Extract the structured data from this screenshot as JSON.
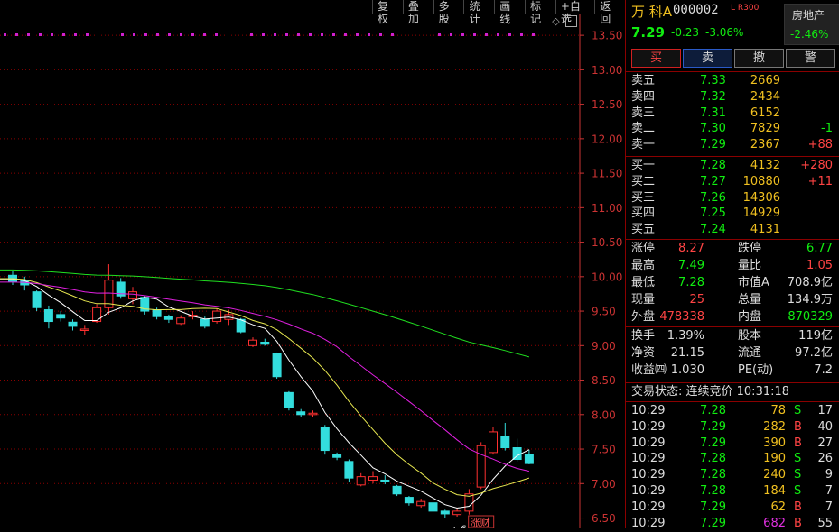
{
  "toolbar": [
    "复权",
    "叠加",
    "多股",
    "统计",
    "画线",
    "标记",
    "+自选",
    "返回"
  ],
  "chart": {
    "y_ticks": [
      "13.50",
      "13.00",
      "12.50",
      "12.00",
      "11.50",
      "11.00",
      "10.50",
      "10.00",
      "9.50",
      "9.00",
      "8.50",
      "8.00",
      "7.50",
      "7.00",
      "6.50"
    ],
    "low_marker": "6.45",
    "event_label": "涨财",
    "colors": {
      "up": "#ff3030",
      "down": "#33dddd",
      "ma5": "#ffffff",
      "ma10": "#e8e850",
      "ma20": "#e020e0",
      "ma60": "#20e020",
      "grid": "#8b0000",
      "axis": "#cc3333"
    }
  },
  "chart_data": {
    "type": "candlestick",
    "ylim": [
      6.35,
      13.75
    ],
    "candles": [
      {
        "o": 10.02,
        "c": 9.93,
        "h": 10.08,
        "l": 9.88
      },
      {
        "o": 9.95,
        "c": 9.88,
        "h": 10.0,
        "l": 9.8
      },
      {
        "o": 9.78,
        "c": 9.55,
        "h": 9.8,
        "l": 9.5
      },
      {
        "o": 9.52,
        "c": 9.35,
        "h": 9.58,
        "l": 9.25
      },
      {
        "o": 9.45,
        "c": 9.4,
        "h": 9.5,
        "l": 9.35
      },
      {
        "o": 9.34,
        "c": 9.28,
        "h": 9.38,
        "l": 9.22
      },
      {
        "o": 9.22,
        "c": 9.24,
        "h": 9.3,
        "l": 9.15
      },
      {
        "o": 9.35,
        "c": 9.55,
        "h": 9.6,
        "l": 9.33
      },
      {
        "o": 9.55,
        "c": 9.95,
        "h": 10.18,
        "l": 9.45
      },
      {
        "o": 9.92,
        "c": 9.72,
        "h": 9.98,
        "l": 9.68
      },
      {
        "o": 9.68,
        "c": 9.78,
        "h": 9.85,
        "l": 9.6
      },
      {
        "o": 9.7,
        "c": 9.5,
        "h": 9.72,
        "l": 9.45
      },
      {
        "o": 9.52,
        "c": 9.42,
        "h": 9.55,
        "l": 9.38
      },
      {
        "o": 9.42,
        "c": 9.38,
        "h": 9.45,
        "l": 9.33
      },
      {
        "o": 9.32,
        "c": 9.4,
        "h": 9.44,
        "l": 9.3
      },
      {
        "o": 9.42,
        "c": 9.44,
        "h": 9.5,
        "l": 9.38
      },
      {
        "o": 9.38,
        "c": 9.28,
        "h": 9.42,
        "l": 9.25
      },
      {
        "o": 9.35,
        "c": 9.5,
        "h": 9.54,
        "l": 9.32
      },
      {
        "o": 9.38,
        "c": 9.45,
        "h": 9.52,
        "l": 9.3
      },
      {
        "o": 9.38,
        "c": 9.2,
        "h": 9.4,
        "l": 9.18
      },
      {
        "o": 9.0,
        "c": 9.08,
        "h": 9.12,
        "l": 8.98
      },
      {
        "o": 9.05,
        "c": 9.02,
        "h": 9.1,
        "l": 9.0
      },
      {
        "o": 8.88,
        "c": 8.55,
        "h": 8.9,
        "l": 8.52
      },
      {
        "o": 8.32,
        "c": 8.1,
        "h": 8.34,
        "l": 8.06
      },
      {
        "o": 8.04,
        "c": 8.0,
        "h": 8.08,
        "l": 7.96
      },
      {
        "o": 8.0,
        "c": 8.02,
        "h": 8.06,
        "l": 7.96
      },
      {
        "o": 7.82,
        "c": 7.48,
        "h": 7.85,
        "l": 7.42
      },
      {
        "o": 7.42,
        "c": 7.38,
        "h": 7.45,
        "l": 7.34
      },
      {
        "o": 7.32,
        "c": 7.08,
        "h": 7.35,
        "l": 7.02
      },
      {
        "o": 6.98,
        "c": 7.1,
        "h": 7.15,
        "l": 6.96
      },
      {
        "o": 7.05,
        "c": 7.1,
        "h": 7.18,
        "l": 7.0
      },
      {
        "o": 7.05,
        "c": 7.04,
        "h": 7.12,
        "l": 6.99
      },
      {
        "o": 6.96,
        "c": 6.85,
        "h": 6.98,
        "l": 6.82
      },
      {
        "o": 6.8,
        "c": 6.72,
        "h": 6.82,
        "l": 6.68
      },
      {
        "o": 6.68,
        "c": 6.74,
        "h": 6.78,
        "l": 6.65
      },
      {
        "o": 6.72,
        "c": 6.6,
        "h": 6.74,
        "l": 6.55
      },
      {
        "o": 6.6,
        "c": 6.56,
        "h": 6.62,
        "l": 6.5
      },
      {
        "o": 6.55,
        "c": 6.6,
        "h": 6.65,
        "l": 6.52
      },
      {
        "o": 6.6,
        "c": 6.85,
        "h": 6.92,
        "l": 6.55
      },
      {
        "o": 6.95,
        "c": 7.55,
        "h": 7.6,
        "l": 6.92
      },
      {
        "o": 7.45,
        "c": 7.75,
        "h": 7.82,
        "l": 7.42
      },
      {
        "o": 7.68,
        "c": 7.52,
        "h": 7.88,
        "l": 7.48
      },
      {
        "o": 7.52,
        "c": 7.35,
        "h": 7.65,
        "l": 7.32
      },
      {
        "o": 7.42,
        "c": 7.29,
        "h": 7.49,
        "l": 7.28
      }
    ]
  },
  "quote": {
    "name": "万 科A",
    "code": "000002",
    "tags": "L R300",
    "price": "7.29",
    "change": "-0.23",
    "change_pct": "-3.06%",
    "sector": "房地产",
    "sector_pct": "-2.46%"
  },
  "buttons": {
    "buy": "买",
    "sell": "卖",
    "cancel": "撤",
    "alert": "警"
  },
  "asks": [
    {
      "label": "卖五",
      "price": "7.33",
      "vol": "2669",
      "delta": ""
    },
    {
      "label": "卖四",
      "price": "7.32",
      "vol": "2434",
      "delta": ""
    },
    {
      "label": "卖三",
      "price": "7.31",
      "vol": "6152",
      "delta": ""
    },
    {
      "label": "卖二",
      "price": "7.30",
      "vol": "7829",
      "delta": "-1"
    },
    {
      "label": "卖一",
      "price": "7.29",
      "vol": "2367",
      "delta": "+88"
    }
  ],
  "bids": [
    {
      "label": "买一",
      "price": "7.28",
      "vol": "4132",
      "delta": "+280"
    },
    {
      "label": "买二",
      "price": "7.27",
      "vol": "10880",
      "delta": "+11"
    },
    {
      "label": "买三",
      "price": "7.26",
      "vol": "14306",
      "delta": ""
    },
    {
      "label": "买四",
      "price": "7.25",
      "vol": "14929",
      "delta": ""
    },
    {
      "label": "买五",
      "price": "7.24",
      "vol": "4131",
      "delta": ""
    }
  ],
  "stats1": [
    {
      "l": "涨停",
      "lv": "8.27",
      "lc": "p-red",
      "r": "跌停",
      "rv": "6.77",
      "rc": "p-green"
    },
    {
      "l": "最高",
      "lv": "7.49",
      "lc": "p-green",
      "r": "量比",
      "rv": "1.05",
      "rc": "p-red"
    },
    {
      "l": "最低",
      "lv": "7.28",
      "lc": "p-green",
      "r": "市值A",
      "rv": "708.9亿",
      "rc": "p-white"
    },
    {
      "l": "现量",
      "lv": "25",
      "lc": "p-red",
      "r": "总量",
      "rv": "134.9万",
      "rc": "p-white"
    },
    {
      "l": "外盘",
      "lv": "478338",
      "lc": "p-red",
      "r": "内盘",
      "rv": "870329",
      "rc": "p-green"
    }
  ],
  "stats2": [
    {
      "l": "换手",
      "lv": "1.39%",
      "lc": "p-white",
      "r": "股本",
      "rv": "119亿",
      "rc": "p-white"
    },
    {
      "l": "净资",
      "lv": "21.15",
      "lc": "p-white",
      "r": "流通",
      "rv": "97.2亿",
      "rc": "p-white"
    },
    {
      "l": "收益㈣",
      "lv": "1.030",
      "lc": "p-white",
      "r": "PE(动)",
      "rv": "7.2",
      "rc": "p-white"
    }
  ],
  "trade_status": "交易状态: 连续竞价 10:31:18",
  "ticks": [
    {
      "t": "10:29",
      "p": "7.28",
      "v": "78",
      "bs": "S",
      "n": "17"
    },
    {
      "t": "10:29",
      "p": "7.29",
      "v": "282",
      "bs": "B",
      "n": "40"
    },
    {
      "t": "10:29",
      "p": "7.29",
      "v": "390",
      "bs": "B",
      "n": "27"
    },
    {
      "t": "10:29",
      "p": "7.28",
      "v": "190",
      "bs": "S",
      "n": "26"
    },
    {
      "t": "10:29",
      "p": "7.28",
      "v": "240",
      "bs": "S",
      "n": "9"
    },
    {
      "t": "10:29",
      "p": "7.28",
      "v": "184",
      "bs": "S",
      "n": "7"
    },
    {
      "t": "10:29",
      "p": "7.29",
      "v": "62",
      "bs": "B",
      "n": "7"
    },
    {
      "t": "10:29",
      "p": "7.29",
      "v": "682",
      "bs": "B",
      "n": "55"
    }
  ]
}
